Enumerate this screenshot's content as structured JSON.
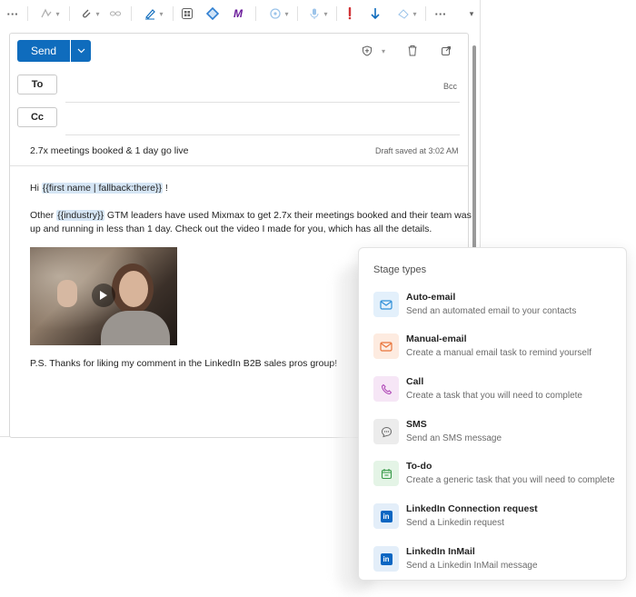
{
  "toolbar": {
    "more_left": "···",
    "more_right": "···",
    "buttons": [
      "format-painter-icon",
      "attach-icon",
      "link-icon",
      "signature-icon",
      "apps-icon",
      "loop-icon",
      "mixmax-icon",
      "copilot-icon",
      "dictate-icon",
      "importance-icon",
      "download-icon",
      "sensitivity-icon"
    ]
  },
  "compose": {
    "send_label": "Send",
    "to_label": "To",
    "cc_label": "Cc",
    "bcc_label": "Bcc",
    "subject": "2.7x meetings booked & 1 day go live",
    "draft_status": "Draft saved at 3:02 AM",
    "greeting_prefix": "Hi ",
    "greeting_token": "{{first name | fallback:there}}",
    "greeting_suffix": " !",
    "para_prefix": "Other ",
    "para_token": "{{industry}}",
    "para_line1": " GTM leaders have used Mixmax to get 2.7x their meetings booked and their team was",
    "para_line2": "up and running in less than 1 day. Check out the video I made for you, which has all the details.",
    "ps": "P.S. Thanks for liking my comment in the LinkedIn B2B sales pros group!"
  },
  "panel": {
    "title": "Stage types",
    "items": [
      {
        "name": "Auto-email",
        "desc": "Send an automated email to your contacts",
        "icon": "mail-icon",
        "bg": "#e3f0fb",
        "fg": "#2f8fd8"
      },
      {
        "name": "Manual-email",
        "desc": "Create a manual email task to remind yourself",
        "icon": "mail-icon",
        "bg": "#fdebe0",
        "fg": "#e9743a"
      },
      {
        "name": "Call",
        "desc": "Create a task that you will need to complete",
        "icon": "phone-icon",
        "bg": "#f6e6f6",
        "fg": "#b04ab8"
      },
      {
        "name": "SMS",
        "desc": "Send an SMS message",
        "icon": "sms-icon",
        "bg": "#ececec",
        "fg": "#6b6b6b"
      },
      {
        "name": "To-do",
        "desc": "Create a generic task that you will need to complete",
        "icon": "calendar-icon",
        "bg": "#e4f4e6",
        "fg": "#3a9a4a"
      },
      {
        "name": "LinkedIn Connection request",
        "desc": "Send a Linkedin request",
        "icon": "linkedin-icon",
        "bg": "#e3eef9",
        "fg": "#0a66c2"
      },
      {
        "name": "LinkedIn InMail",
        "desc": "Send a Linkedin InMail message",
        "icon": "linkedin-icon",
        "bg": "#e3eef9",
        "fg": "#0a66c2"
      }
    ]
  }
}
